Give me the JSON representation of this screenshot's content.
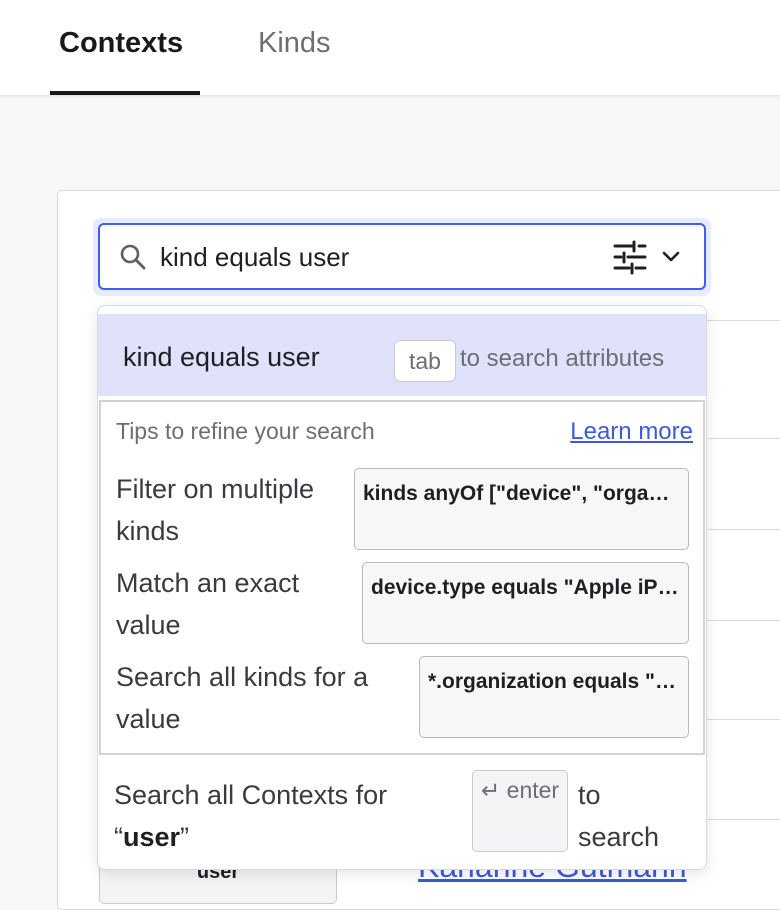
{
  "tabs": [
    {
      "label": "Contexts",
      "active": true
    },
    {
      "label": "Kinds",
      "active": false
    }
  ],
  "search": {
    "value": "kind equals user",
    "icons": {
      "search": "search-icon",
      "filter": "sliders-icon",
      "toggle": "chevron-down-icon"
    }
  },
  "suggestion": {
    "text": "kind equals user",
    "key_label": "tab",
    "hint": "to search attributes"
  },
  "tips": {
    "title": "Tips to refine your search",
    "learn_more": "Learn more",
    "items": [
      {
        "label_line1": "Filter on multiple",
        "label_line2": "kinds",
        "example": "kinds anyOf [\"device\", \"organization\"]"
      },
      {
        "label_line1": "Match an exact",
        "label_line2": "value",
        "example": "device.type equals \"Apple iPhone\""
      },
      {
        "label_line1": "Search all kinds for a",
        "label_line2": "value",
        "example": "*.organization equals \"Acme\""
      }
    ]
  },
  "footer": {
    "prefix": "Search all Contexts for",
    "open_quote": "“",
    "query": "user",
    "close_quote": "”",
    "key_glyph": "↵",
    "key_label": "enter",
    "suffix_line1": "to",
    "suffix_line2": "search"
  },
  "background_row": {
    "kind": "user",
    "name": "Karianne Gutmann"
  },
  "colors": {
    "accent": "#405bff",
    "link": "#3b5bdb",
    "suggestion_highlight": "#dfe2fa"
  }
}
